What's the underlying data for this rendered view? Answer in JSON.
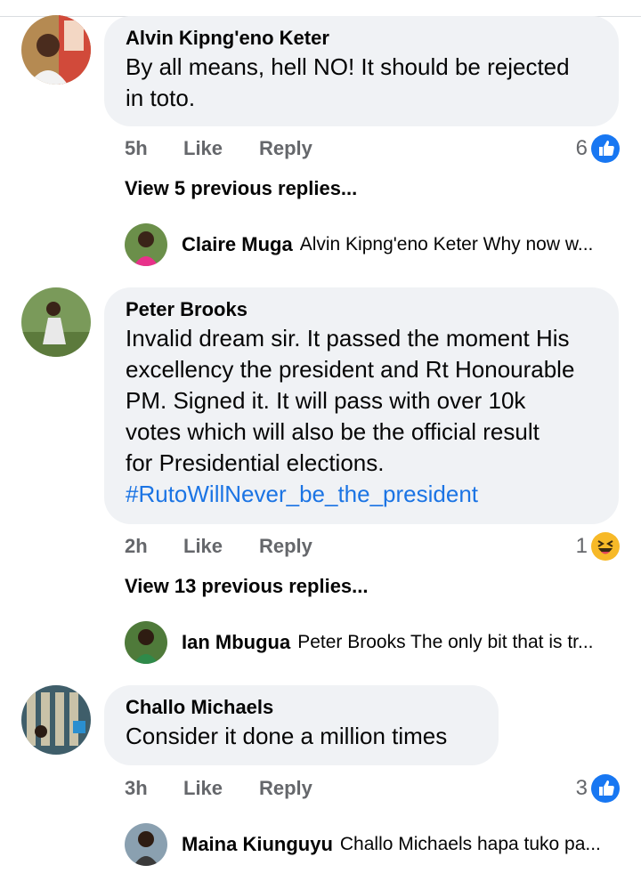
{
  "comments": [
    {
      "author": "Alvin Kipng'eno Keter",
      "lines": [
        "By all means, hell NO! It should be rejected",
        "in toto."
      ],
      "time": "5h",
      "like_label": "Like",
      "reply_label": "Reply",
      "reaction_count": "6",
      "reaction_icon": "like-icon",
      "view_previous": "View 5 previous replies...",
      "latest_reply": {
        "author": "Claire Muga",
        "text": "Alvin Kipng'eno Keter Why now w..."
      }
    },
    {
      "author": "Peter Brooks",
      "lines": [
        "Invalid dream sir. It passed the moment His",
        "excellency the president and Rt Honourable",
        "PM. Signed it. It will pass with over 10k",
        "votes which will also be the official result",
        "for Presidential elections."
      ],
      "hashtag": "#RutoWillNever_be_the_president",
      "time": "2h",
      "like_label": "Like",
      "reply_label": "Reply",
      "reaction_count": "1",
      "reaction_icon": "haha-icon",
      "view_previous": "View 13 previous replies...",
      "latest_reply": {
        "author": "Ian Mbugua",
        "text": "Peter Brooks The only bit that is tr..."
      }
    },
    {
      "author": "Challo Michaels",
      "lines": [
        "Consider it done a million times"
      ],
      "time": "3h",
      "like_label": "Like",
      "reply_label": "Reply",
      "reaction_count": "3",
      "reaction_icon": "like-icon",
      "latest_reply": {
        "author": "Maina Kiunguyu",
        "text": "Challo Michaels hapa tuko pa..."
      }
    }
  ],
  "colors": {
    "bubble": "#f0f2f5",
    "hashtag": "#1b74e4",
    "meta": "#65676b",
    "like_blue": "#1877f2",
    "haha_yellow": "#f7b928"
  }
}
